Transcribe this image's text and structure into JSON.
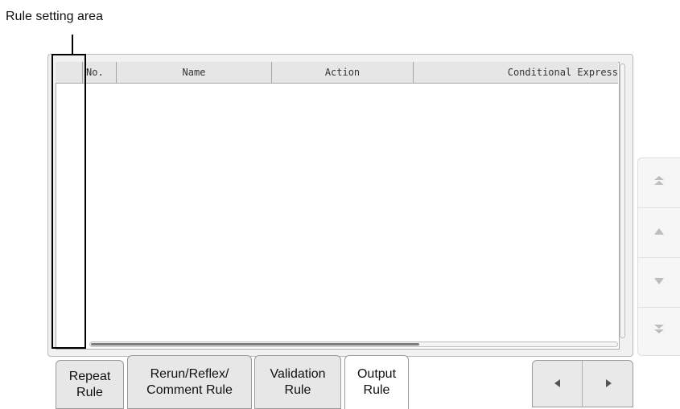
{
  "callout": {
    "label": "Rule setting area"
  },
  "table": {
    "columns": [
      "",
      "No.",
      "Name",
      "Action",
      "Conditional Express"
    ]
  },
  "side_nav": {
    "buttons": [
      {
        "icon": "double-up-icon",
        "glyph": "⏶"
      },
      {
        "icon": "up-icon",
        "glyph": "▲"
      },
      {
        "icon": "down-icon",
        "glyph": "▼"
      },
      {
        "icon": "double-down-icon",
        "glyph": "⏷"
      }
    ]
  },
  "tabs": [
    {
      "label": "Repeat\nRule",
      "active": false
    },
    {
      "label": "Rerun/Reflex/\nComment Rule",
      "active": false
    },
    {
      "label": "Validation\nRule",
      "active": false
    },
    {
      "label": "Output\nRule",
      "active": true
    }
  ],
  "pager": {
    "prev_icon": "◀",
    "next_icon": "▶"
  },
  "colors": {
    "panel_bg": "#f1f1f1",
    "header_bg": "#e6e6e6",
    "tab_bg": "#e7e7e7",
    "active_tab_bg": "#ffffff",
    "callout_border": "#000000"
  }
}
